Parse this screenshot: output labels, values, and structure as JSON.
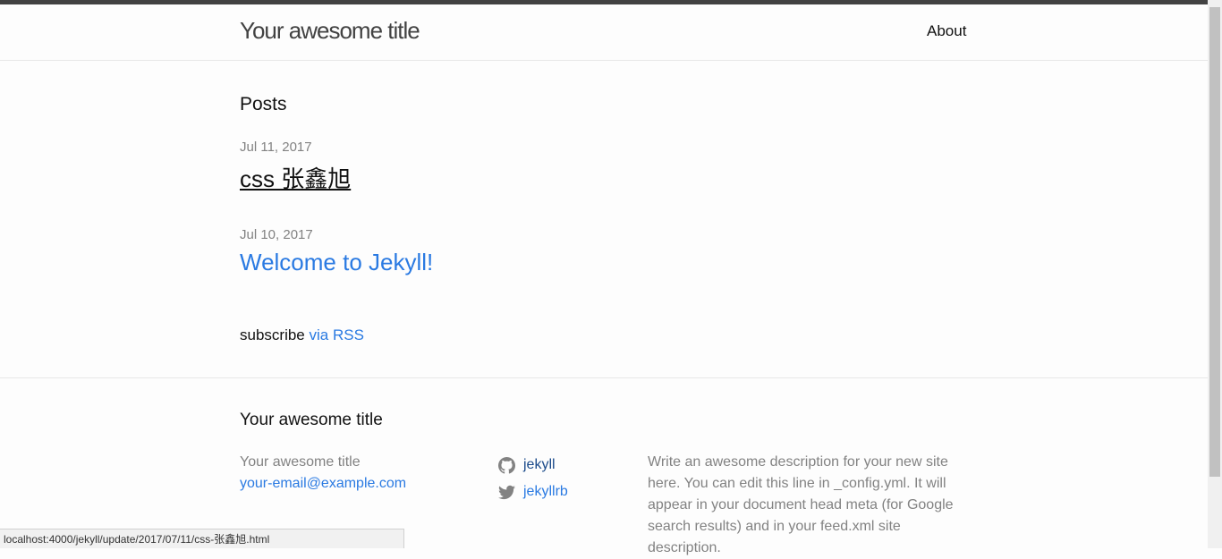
{
  "header": {
    "site_title": "Your awesome title",
    "nav": {
      "about_label": "About"
    }
  },
  "main": {
    "heading": "Posts",
    "posts": [
      {
        "date": "Jul 11, 2017",
        "title": "css 张鑫旭",
        "state": "visited"
      },
      {
        "date": "Jul 10, 2017",
        "title": "Welcome to Jekyll!",
        "state": "normal"
      }
    ],
    "rss": {
      "prefix": "subscribe",
      "link_label": "via RSS"
    }
  },
  "footer": {
    "heading": "Your awesome title",
    "name": "Your awesome title",
    "email": "your-email@example.com",
    "social": [
      {
        "icon": "github-icon",
        "label": "jekyll"
      },
      {
        "icon": "twitter-icon",
        "label": "jekyllrb"
      }
    ],
    "description": "Write an awesome description for your new site here. You can edit this line in _config.yml. It will appear in your document head meta (for Google search results) and in your feed.xml site description."
  },
  "status_bar": {
    "url": "localhost:4000/jekyll/update/2017/07/11/css-张鑫旭.html"
  },
  "colors": {
    "link": "#2a7ae2",
    "muted": "#828282",
    "top_bar": "#424242"
  }
}
